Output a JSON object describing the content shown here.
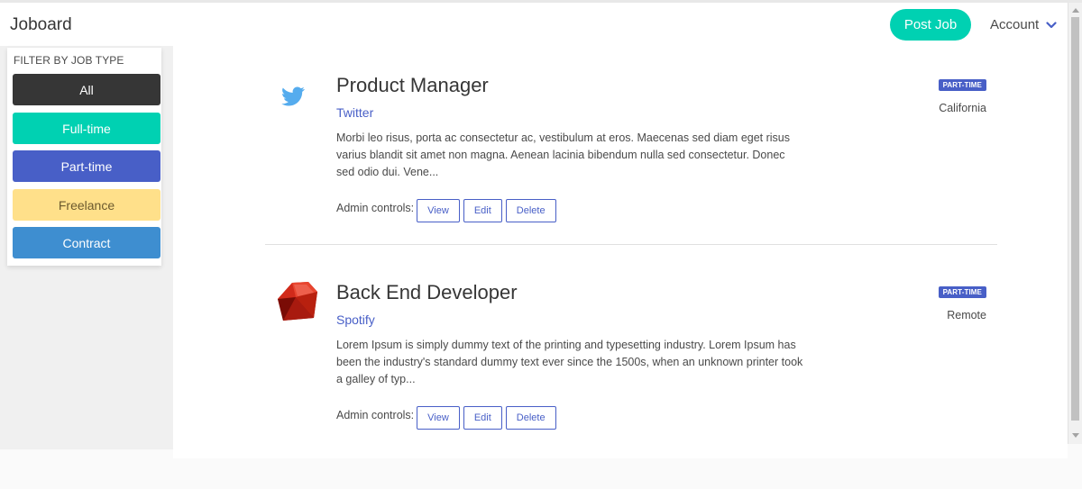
{
  "navbar": {
    "brand": "Joboard",
    "post_job_label": "Post Job",
    "account_label": "Account"
  },
  "sidebar": {
    "filter_title": "FILTER BY JOB TYPE",
    "filters": [
      {
        "label": "All",
        "color": "#363636"
      },
      {
        "label": "Full-time",
        "color": "#00d1b2"
      },
      {
        "label": "Part-time",
        "color": "#485fc7"
      },
      {
        "label": "Freelance",
        "color": "#ffe08a"
      },
      {
        "label": "Contract",
        "color": "#3e8ed0"
      }
    ]
  },
  "jobs": [
    {
      "title": "Product Manager",
      "company": "Twitter",
      "logo_icon": "twitter-bird-icon",
      "description": "Morbi leo risus, porta ac consectetur ac, vestibulum at eros. Maecenas sed diam eget risus varius blandit sit amet non magna. Aenean lacinia bibendum nulla sed consectetur. Donec sed odio dui. Vene...",
      "type_badge": "PART-TIME",
      "location": "California",
      "admin_label": "Admin controls:",
      "actions": [
        "View",
        "Edit",
        "Delete"
      ]
    },
    {
      "title": "Back End Developer",
      "company": "Spotify",
      "logo_icon": "ruby-gem-icon",
      "description": "Lorem Ipsum is simply dummy text of the printing and typesetting industry. Lorem Ipsum has been the industry's standard dummy text ever since the 1500s, when an unknown printer took a galley of typ...",
      "type_badge": "PART-TIME",
      "location": "Remote",
      "admin_label": "Admin controls:",
      "actions": [
        "View",
        "Edit",
        "Delete"
      ]
    }
  ],
  "colors": {
    "primary": "#00d1b2",
    "link": "#485fc7",
    "dark": "#363636"
  }
}
